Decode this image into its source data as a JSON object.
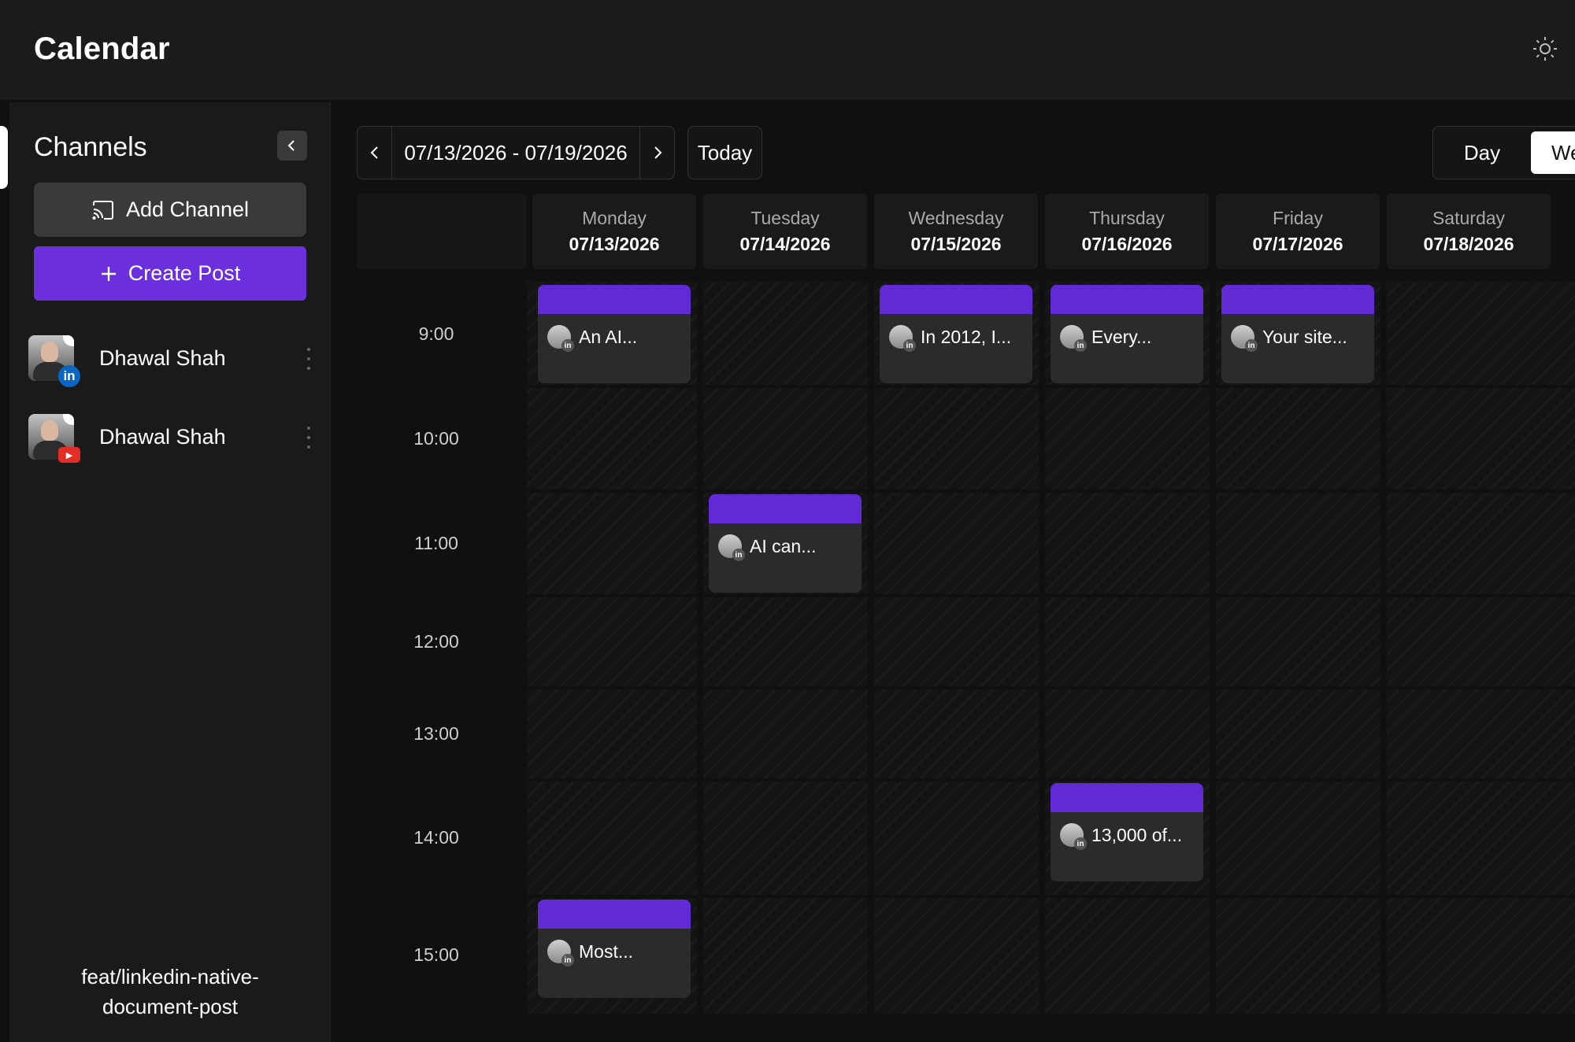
{
  "app": {
    "title": "Calendar"
  },
  "icons": {
    "theme": "sun-icon",
    "collapse": "chevron-left-icon",
    "add_channel": "cast-icon",
    "create_post": "plus-icon",
    "prev": "chevron-left-icon",
    "next": "chevron-right-icon",
    "more": "more-vertical-icon"
  },
  "colors": {
    "accent": "#6b2fde",
    "event_bar": "#6229d6",
    "linkedin": "#0a66c2",
    "youtube": "#e52d27"
  },
  "sidebar": {
    "title": "Channels",
    "add_channel_label": "Add Channel",
    "create_post_label": "Create Post",
    "channels": [
      {
        "name": "Dhawal Shah",
        "platform": "linkedin",
        "badge": "in"
      },
      {
        "name": "Dhawal Shah",
        "platform": "youtube",
        "badge": "▶"
      }
    ],
    "branch_line1": "feat/linkedin-native-",
    "branch_line2": "document-post"
  },
  "toolbar": {
    "date_range": "07/13/2026 - 07/19/2026",
    "today_label": "Today",
    "view_day_label": "Day",
    "view_week_label": "Week"
  },
  "calendar": {
    "days": [
      {
        "name": "Monday",
        "date": "07/13/2026"
      },
      {
        "name": "Tuesday",
        "date": "07/14/2026"
      },
      {
        "name": "Wednesday",
        "date": "07/15/2026"
      },
      {
        "name": "Thursday",
        "date": "07/16/2026"
      },
      {
        "name": "Friday",
        "date": "07/17/2026"
      },
      {
        "name": "Saturday",
        "date": "07/18/2026"
      }
    ],
    "hours": [
      "9:00",
      "10:00",
      "11:00",
      "12:00",
      "13:00",
      "14:00",
      "15:00"
    ],
    "events": [
      {
        "day": "Monday",
        "hour": "9:00",
        "text": "An AI..."
      },
      {
        "day": "Wednesday",
        "hour": "9:00",
        "text": "In 2012, I..."
      },
      {
        "day": "Thursday",
        "hour": "9:00",
        "text": "Every..."
      },
      {
        "day": "Friday",
        "hour": "9:00",
        "text": "Your site..."
      },
      {
        "day": "Tuesday",
        "hour": "11:00",
        "text": "AI can..."
      },
      {
        "day": "Thursday",
        "hour": "14:00",
        "text": "13,000 of..."
      },
      {
        "day": "Monday",
        "hour": "15:00",
        "text": "Most..."
      }
    ],
    "event_badge": "in"
  }
}
